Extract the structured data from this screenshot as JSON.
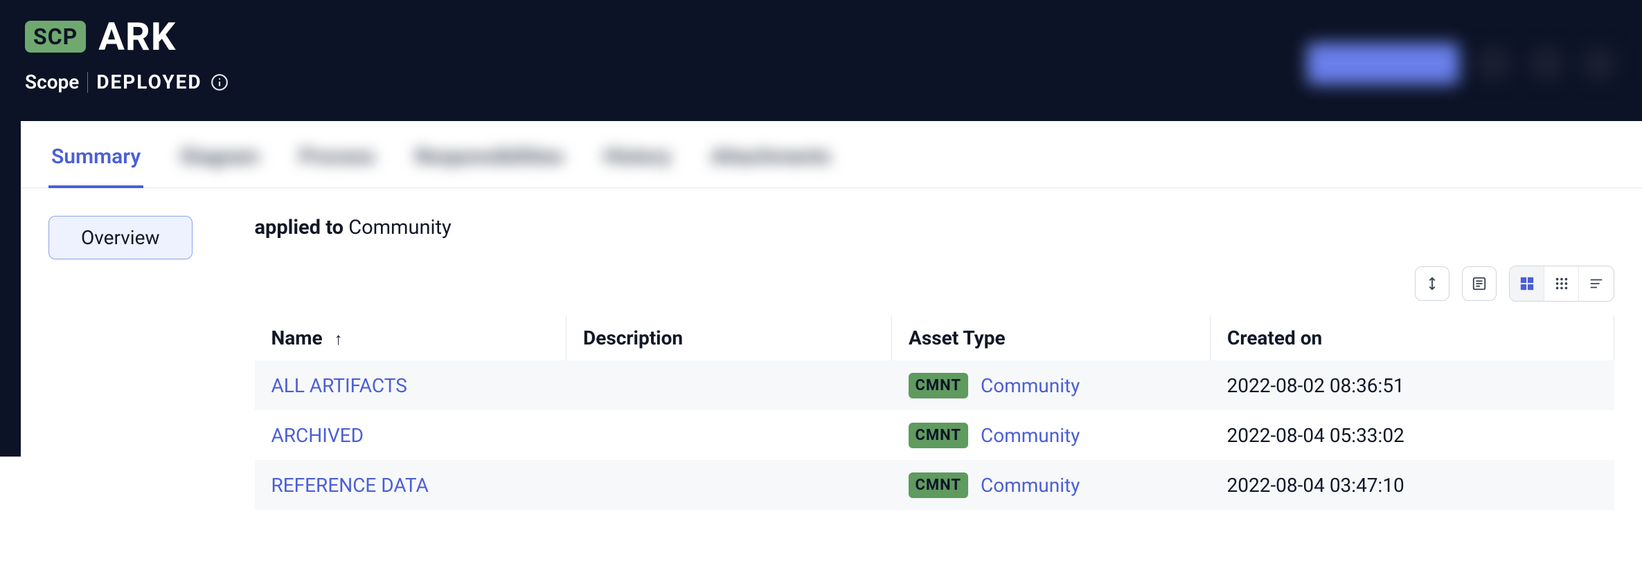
{
  "header": {
    "badge": "SCP",
    "title": "ARK",
    "scope_label": "Scope",
    "status": "DEPLOYED"
  },
  "tabs": [
    {
      "label": "Summary",
      "active": true
    },
    {
      "label": "Diagram",
      "active": false,
      "blur": true
    },
    {
      "label": "Process",
      "active": false,
      "blur": true
    },
    {
      "label": "Responsibilities",
      "active": false,
      "blur": true
    },
    {
      "label": "History",
      "active": false,
      "blur": true
    },
    {
      "label": "Attachments",
      "active": false,
      "blur": true
    }
  ],
  "sidebar": {
    "overview": "Overview"
  },
  "applied": {
    "label": "applied to",
    "value": "Community"
  },
  "columns": {
    "name": "Name",
    "description": "Description",
    "asset_type": "Asset Type",
    "created_on": "Created on"
  },
  "rows": [
    {
      "name": "ALL ARTIFACTS",
      "description": "",
      "asset_badge": "CMNT",
      "asset_type": "Community",
      "created_on": "2022-08-02 08:36:51"
    },
    {
      "name": "ARCHIVED",
      "description": "",
      "asset_badge": "CMNT",
      "asset_type": "Community",
      "created_on": "2022-08-04 05:33:02"
    },
    {
      "name": "REFERENCE DATA",
      "description": "",
      "asset_badge": "CMNT",
      "asset_type": "Community",
      "created_on": "2022-08-04 03:47:10"
    }
  ]
}
